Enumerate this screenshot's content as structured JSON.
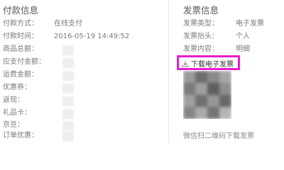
{
  "payment_info": {
    "title": "付款信息",
    "rows": [
      {
        "label": "付款方式：",
        "value": "在线支付"
      },
      {
        "label": "付款时间：",
        "value": "2016-05-19 14:49:52"
      },
      {
        "label": "商品总额：",
        "value": ""
      },
      {
        "label": "应支付金额：",
        "value": ""
      },
      {
        "label": "运费金额：",
        "value": ""
      },
      {
        "label": "优惠券：",
        "value": ""
      },
      {
        "label": "返现：",
        "value": ""
      },
      {
        "label": "礼品卡：",
        "value": ""
      },
      {
        "label": "京豆：",
        "value": ""
      },
      {
        "label": "订单优惠：",
        "value": ""
      }
    ]
  },
  "invoice_info": {
    "title": "发票信息",
    "rows": [
      {
        "label": "发票类型：",
        "value": "电子发票"
      },
      {
        "label": "发票抬头：",
        "value": "个人"
      },
      {
        "label": "发票内容：",
        "value": "明细"
      }
    ],
    "download_button": {
      "label": "下载电子发票",
      "icon": "download-icon",
      "highlight_color": "#e81bd1"
    },
    "qr_caption": "微信扫二维码下载发票"
  }
}
